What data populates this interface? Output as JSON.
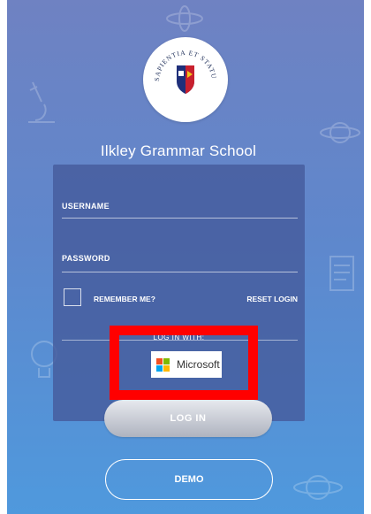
{
  "school": {
    "name": "Ilkley Grammar School",
    "crest_motto": "SAPIENTIA ET STATURA PROFICIAMUS"
  },
  "form": {
    "username_label": "USERNAME",
    "password_label": "PASSWORD",
    "remember_label": "REMEMBER ME?",
    "reset_label": "RESET LOGIN",
    "login_with_label": "LOG IN WITH:"
  },
  "sso": {
    "microsoft_label": "Microsoft"
  },
  "actions": {
    "login_label": "LOG IN",
    "demo_label": "DEMO"
  },
  "colors": {
    "highlight": "#ff0000",
    "ms_red": "#f25022",
    "ms_green": "#7fba00",
    "ms_blue": "#00a4ef",
    "ms_yellow": "#ffb900"
  }
}
